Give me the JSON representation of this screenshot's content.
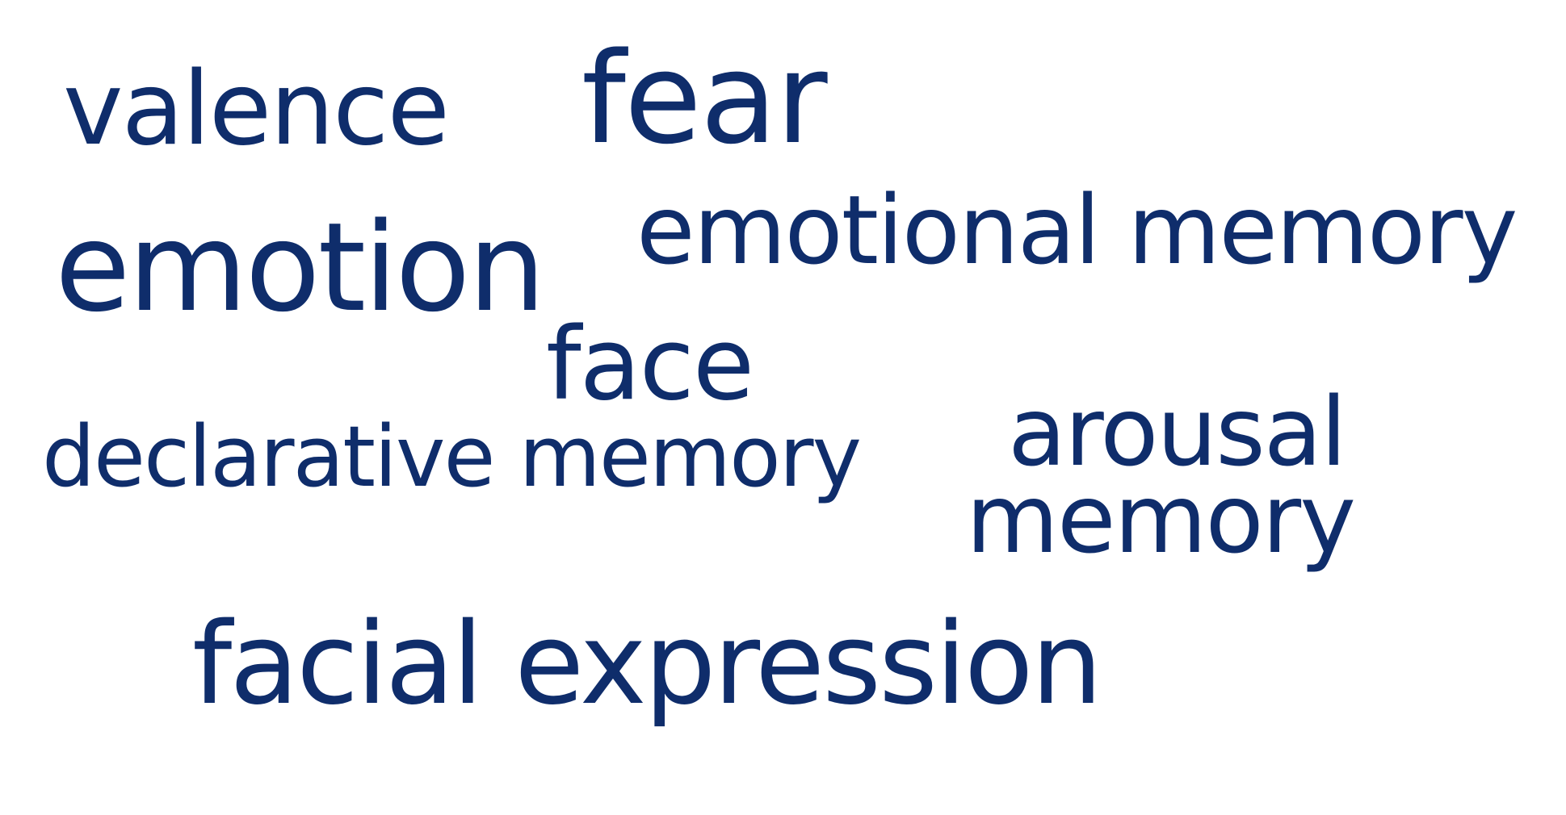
{
  "colors": {
    "text": "#0f2d6b",
    "background": "#ffffff"
  },
  "words": {
    "valence": "valence",
    "fear": "fear",
    "emotion": "emotion",
    "emotional_memory": "emotional memory",
    "face": "face",
    "declarative_memory": "declarative memory",
    "arousal": "arousal",
    "memory": "memory",
    "facial_expression": "facial expression"
  }
}
